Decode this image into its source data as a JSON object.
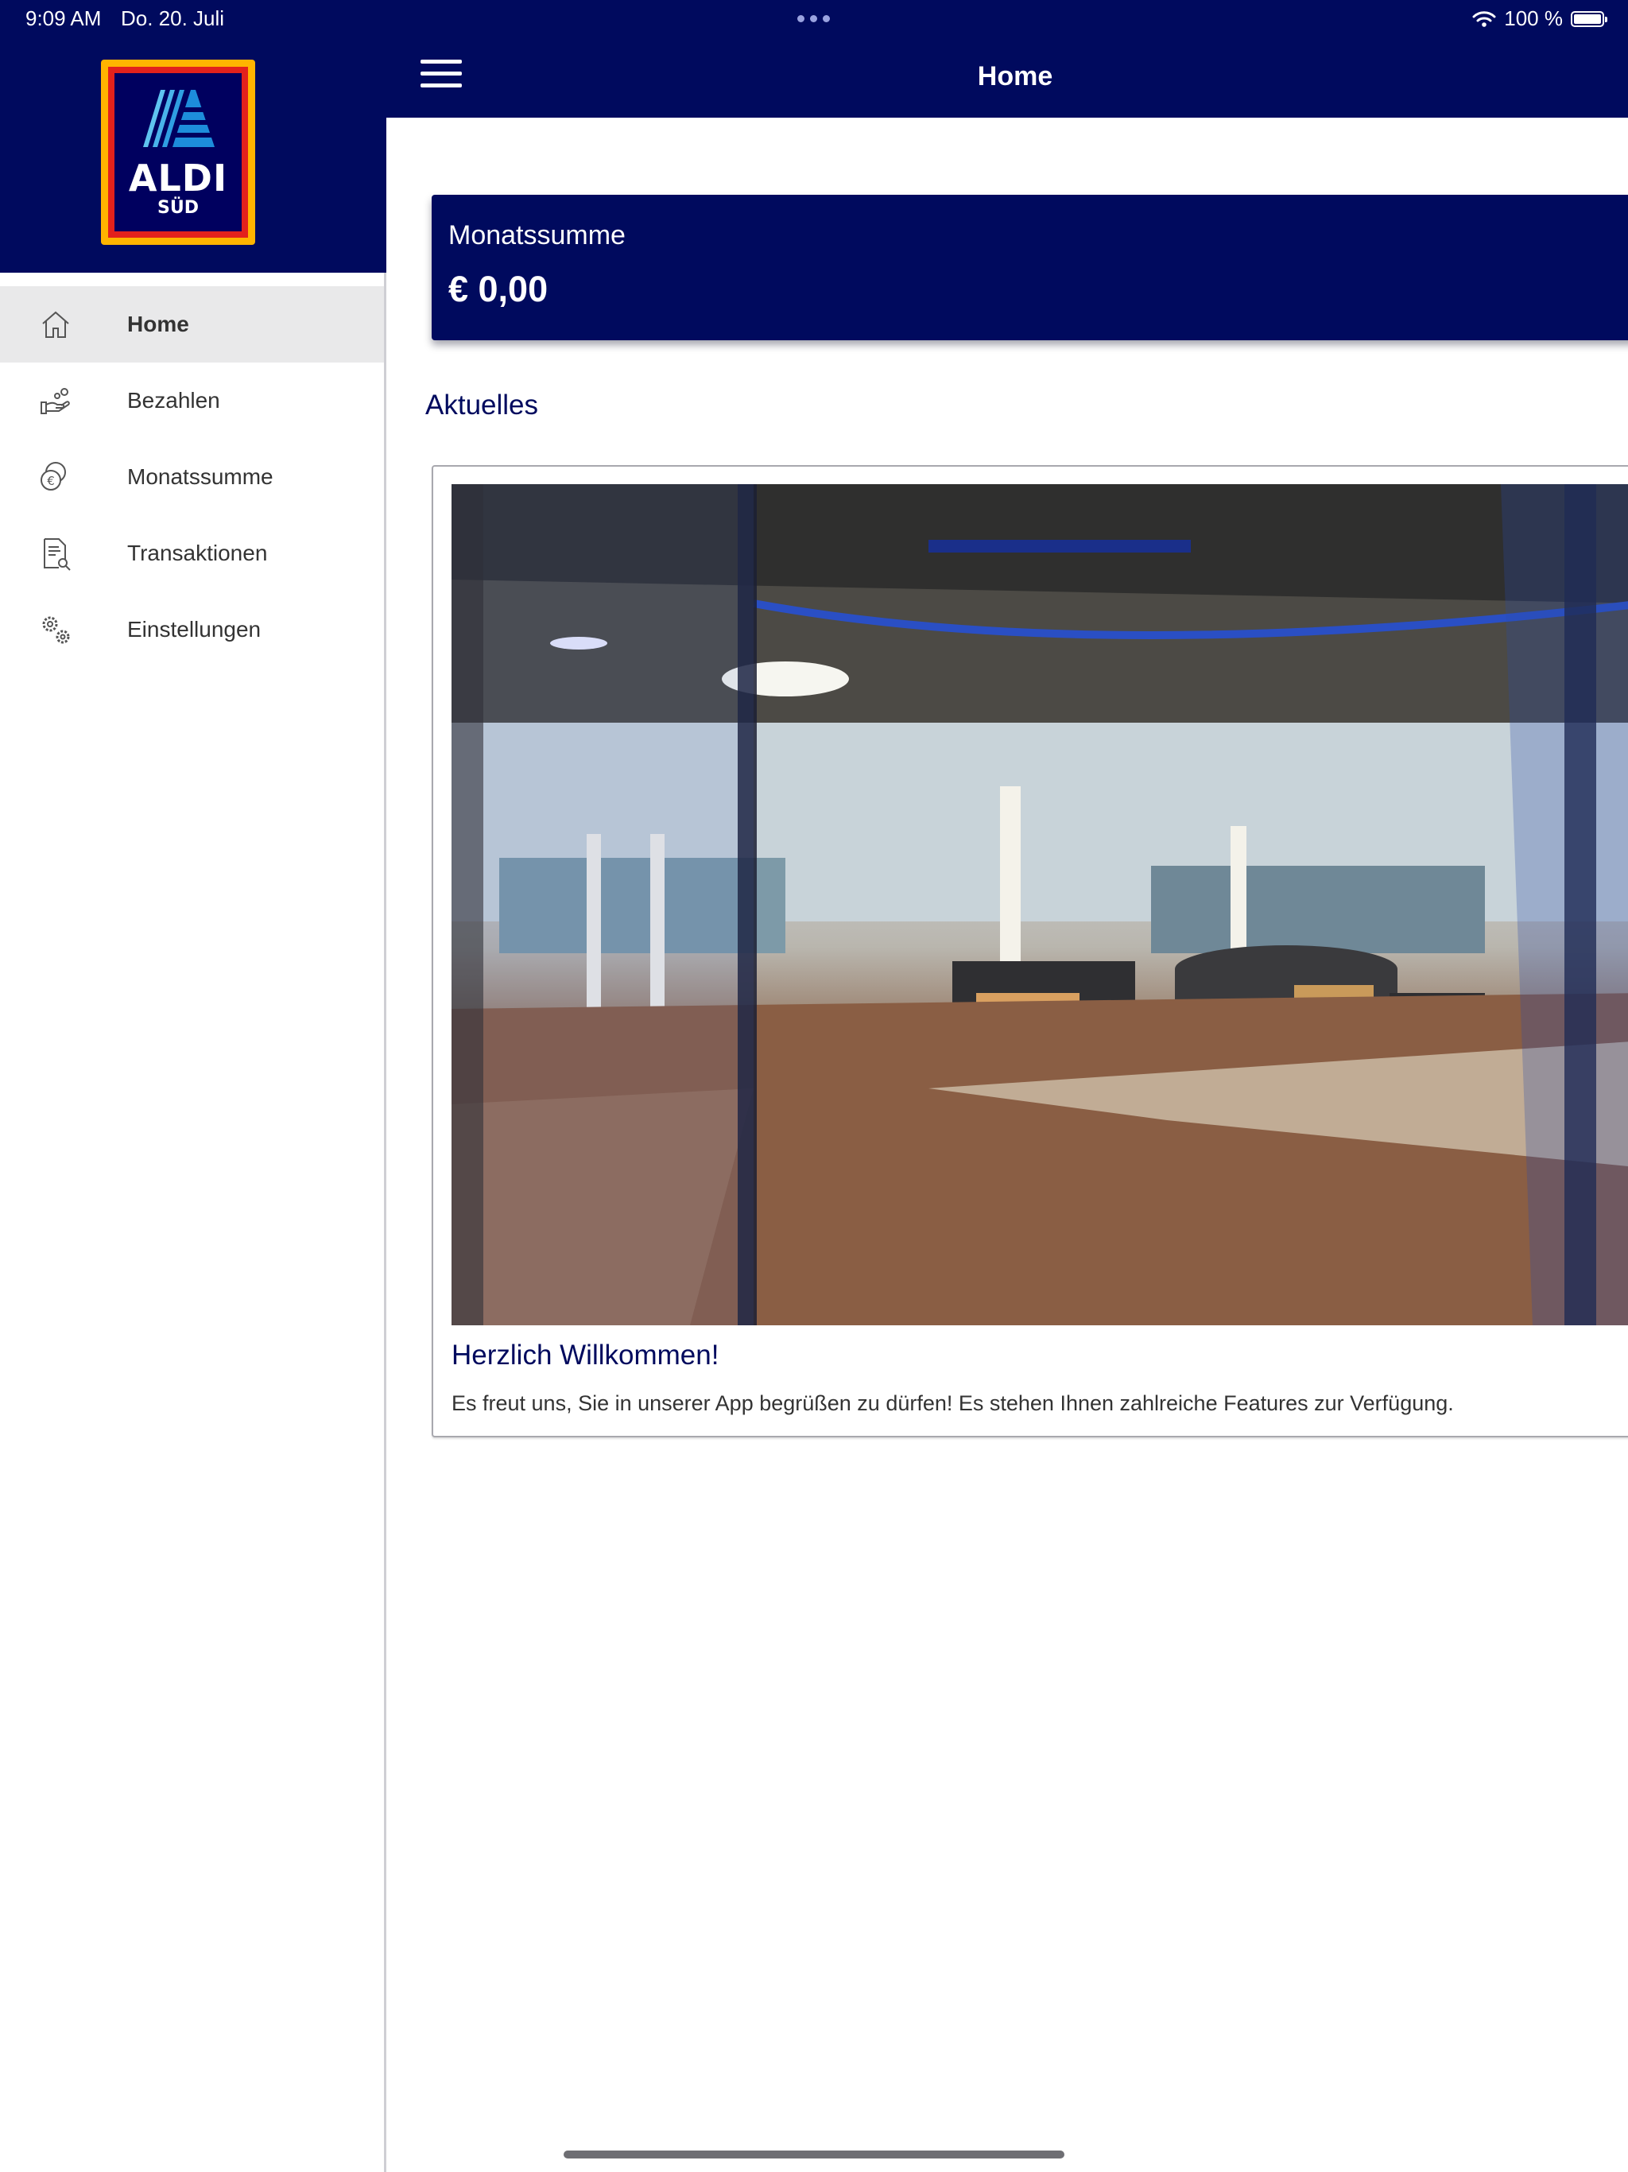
{
  "status_bar": {
    "time": "9:09 AM",
    "date": "Do. 20. Juli",
    "battery": "100 %"
  },
  "logo": {
    "brand": "ALDI",
    "sub": "SÜD"
  },
  "sidebar": {
    "items": [
      {
        "label": "Home",
        "icon": "home-icon",
        "active": true
      },
      {
        "label": "Bezahlen",
        "icon": "pay-hand-icon",
        "active": false
      },
      {
        "label": "Monatssumme",
        "icon": "euro-coins-icon",
        "active": false
      },
      {
        "label": "Transaktionen",
        "icon": "document-search-icon",
        "active": false
      },
      {
        "label": "Einstellungen",
        "icon": "gears-icon",
        "active": false
      }
    ]
  },
  "header": {
    "title": "Home"
  },
  "summary": {
    "label": "Monatssumme",
    "value": "€ 0,00"
  },
  "section": {
    "title": "Aktuelles"
  },
  "news": {
    "title": "Herzlich Willkommen!",
    "text": "Es freut uns, Sie in unserer App begrüßen zu dürfen! Es stehen Ihnen zahlreiche Features zur Verfügung."
  },
  "colors": {
    "brand_navy": "#000a5e",
    "logo_yellow": "#ffb400",
    "logo_red": "#e3211c",
    "active_row": "#e9e9ea"
  }
}
